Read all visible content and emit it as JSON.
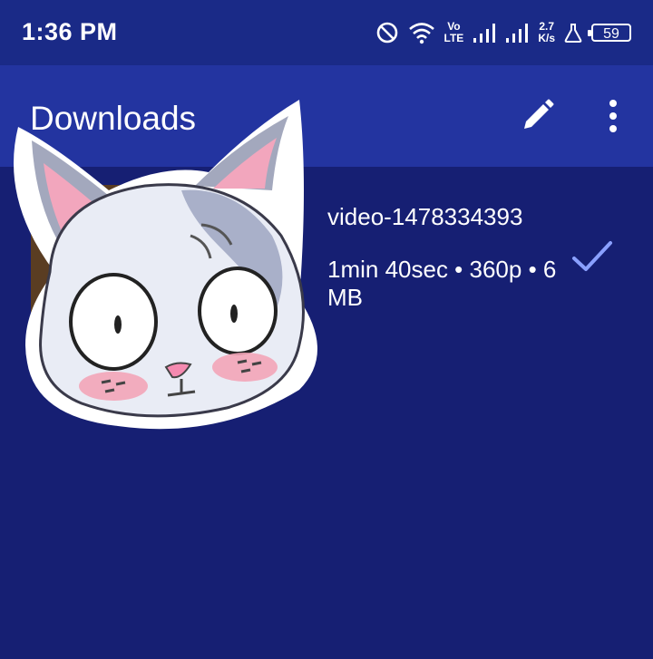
{
  "status_bar": {
    "time": "1:36 PM",
    "volte_top": "Vo",
    "volte_bottom": "LTE",
    "net_speed_value": "2.7",
    "net_speed_unit": "K/s",
    "battery_level": "59"
  },
  "app_bar": {
    "title": "Downloads"
  },
  "downloads": {
    "item_title": "video-1478334393",
    "item_meta": "1min 40sec • 360p • 6 MB"
  },
  "colors": {
    "background": "#161f73",
    "app_bar": "#2334a0",
    "status_bar": "#1a2a87",
    "check": "#8aa0ff"
  }
}
